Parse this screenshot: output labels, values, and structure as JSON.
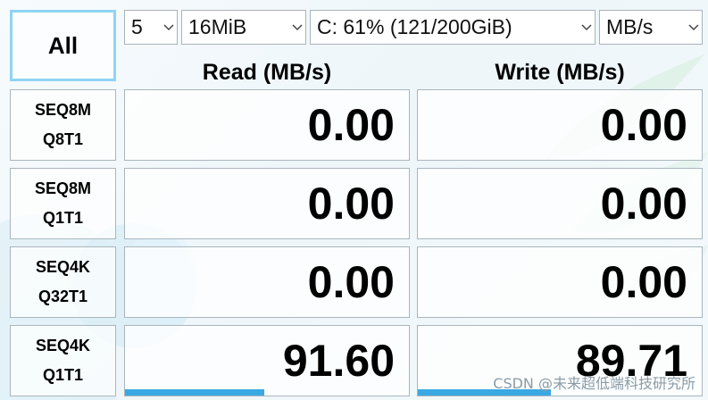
{
  "all_button": "All",
  "selects": {
    "count": "5",
    "size": "16MiB",
    "drive": "C: 61% (121/200GiB)",
    "unit": "MB/s"
  },
  "headers": {
    "read": "Read (MB/s)",
    "write": "Write (MB/s)"
  },
  "rows": [
    {
      "line1": "SEQ8M",
      "line2": "Q8T1",
      "read": "0.00",
      "write": "0.00",
      "read_level": 0,
      "write_level": 0
    },
    {
      "line1": "SEQ8M",
      "line2": "Q1T1",
      "read": "0.00",
      "write": "0.00",
      "read_level": 0,
      "write_level": 0
    },
    {
      "line1": "SEQ4K",
      "line2": "Q32T1",
      "read": "0.00",
      "write": "0.00",
      "read_level": 0,
      "write_level": 0
    },
    {
      "line1": "SEQ4K",
      "line2": "Q1T1",
      "read": "91.60",
      "write": "89.71",
      "read_level": 0.49,
      "write_level": 0.47
    }
  ],
  "watermark": "CSDN @未来超低端科技研究所",
  "colors": {
    "accent": "#8fd4f4",
    "bar": "#3aa8e2",
    "border": "#aab6bd"
  }
}
